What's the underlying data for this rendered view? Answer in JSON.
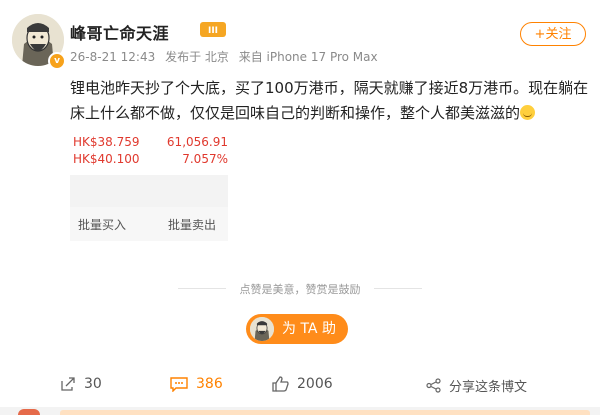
{
  "post": {
    "username": "峰哥亡命天涯",
    "vip_badge": "III",
    "meta": {
      "timestamp": "26-8-21 12:43",
      "location": "发布于 北京",
      "device": "来自 iPhone 17 Pro Max"
    },
    "follow_label": "+关注",
    "text": "锂电池昨天抄了个大底，买了100万港币，隔天就赚了接近8万港币。现在躺在床上什么都不做，仅仅是回味自己的判断和操作，整个人都美滋滋的"
  },
  "trade_card": {
    "row1": {
      "price": "HK$38.759",
      "value": "61,056.91"
    },
    "row2": {
      "price": "HK$40.100",
      "value": "7.057%"
    },
    "buy_label": "批量买入",
    "sell_label": "批量卖出"
  },
  "reward": {
    "divider_text": "点赞是美意，赞赏是鼓励",
    "support_label": "为 TA 助威"
  },
  "actions": {
    "share_count": "30",
    "comment_count": "386",
    "like_count": "2006",
    "share_to_weibo_label": "分享这条博文"
  },
  "colors": {
    "accent": "#ff8200",
    "price_red": "#e0392e"
  },
  "icons": [
    "avatar",
    "vip-crown-icon",
    "share-icon",
    "comment-icon",
    "like-icon",
    "share-network-icon"
  ]
}
